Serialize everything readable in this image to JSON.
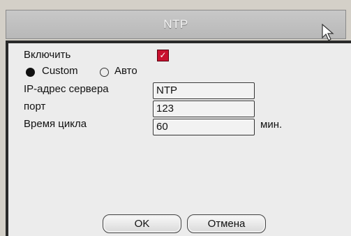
{
  "dialog": {
    "title": "NTP",
    "enable_label": "Включить",
    "enable_checked": true,
    "radio_custom_label": "Custom",
    "radio_auto_label": "Авто",
    "selected_mode": "Custom",
    "server_label": "IP-адрес сервера",
    "server_value": "NTP",
    "port_label": "порт",
    "port_value": "123",
    "cycle_label": "Время цикла",
    "cycle_value": "60",
    "cycle_unit": "мин.",
    "ok_label": "OK",
    "cancel_label": "Отмена"
  },
  "colors": {
    "checkbox": "#c8102e",
    "title_bar": "#c0c0c0",
    "panel": "#ececec"
  },
  "icons": {
    "checkbox_mark": "check-icon",
    "pointer": "mouse-cursor-icon"
  }
}
